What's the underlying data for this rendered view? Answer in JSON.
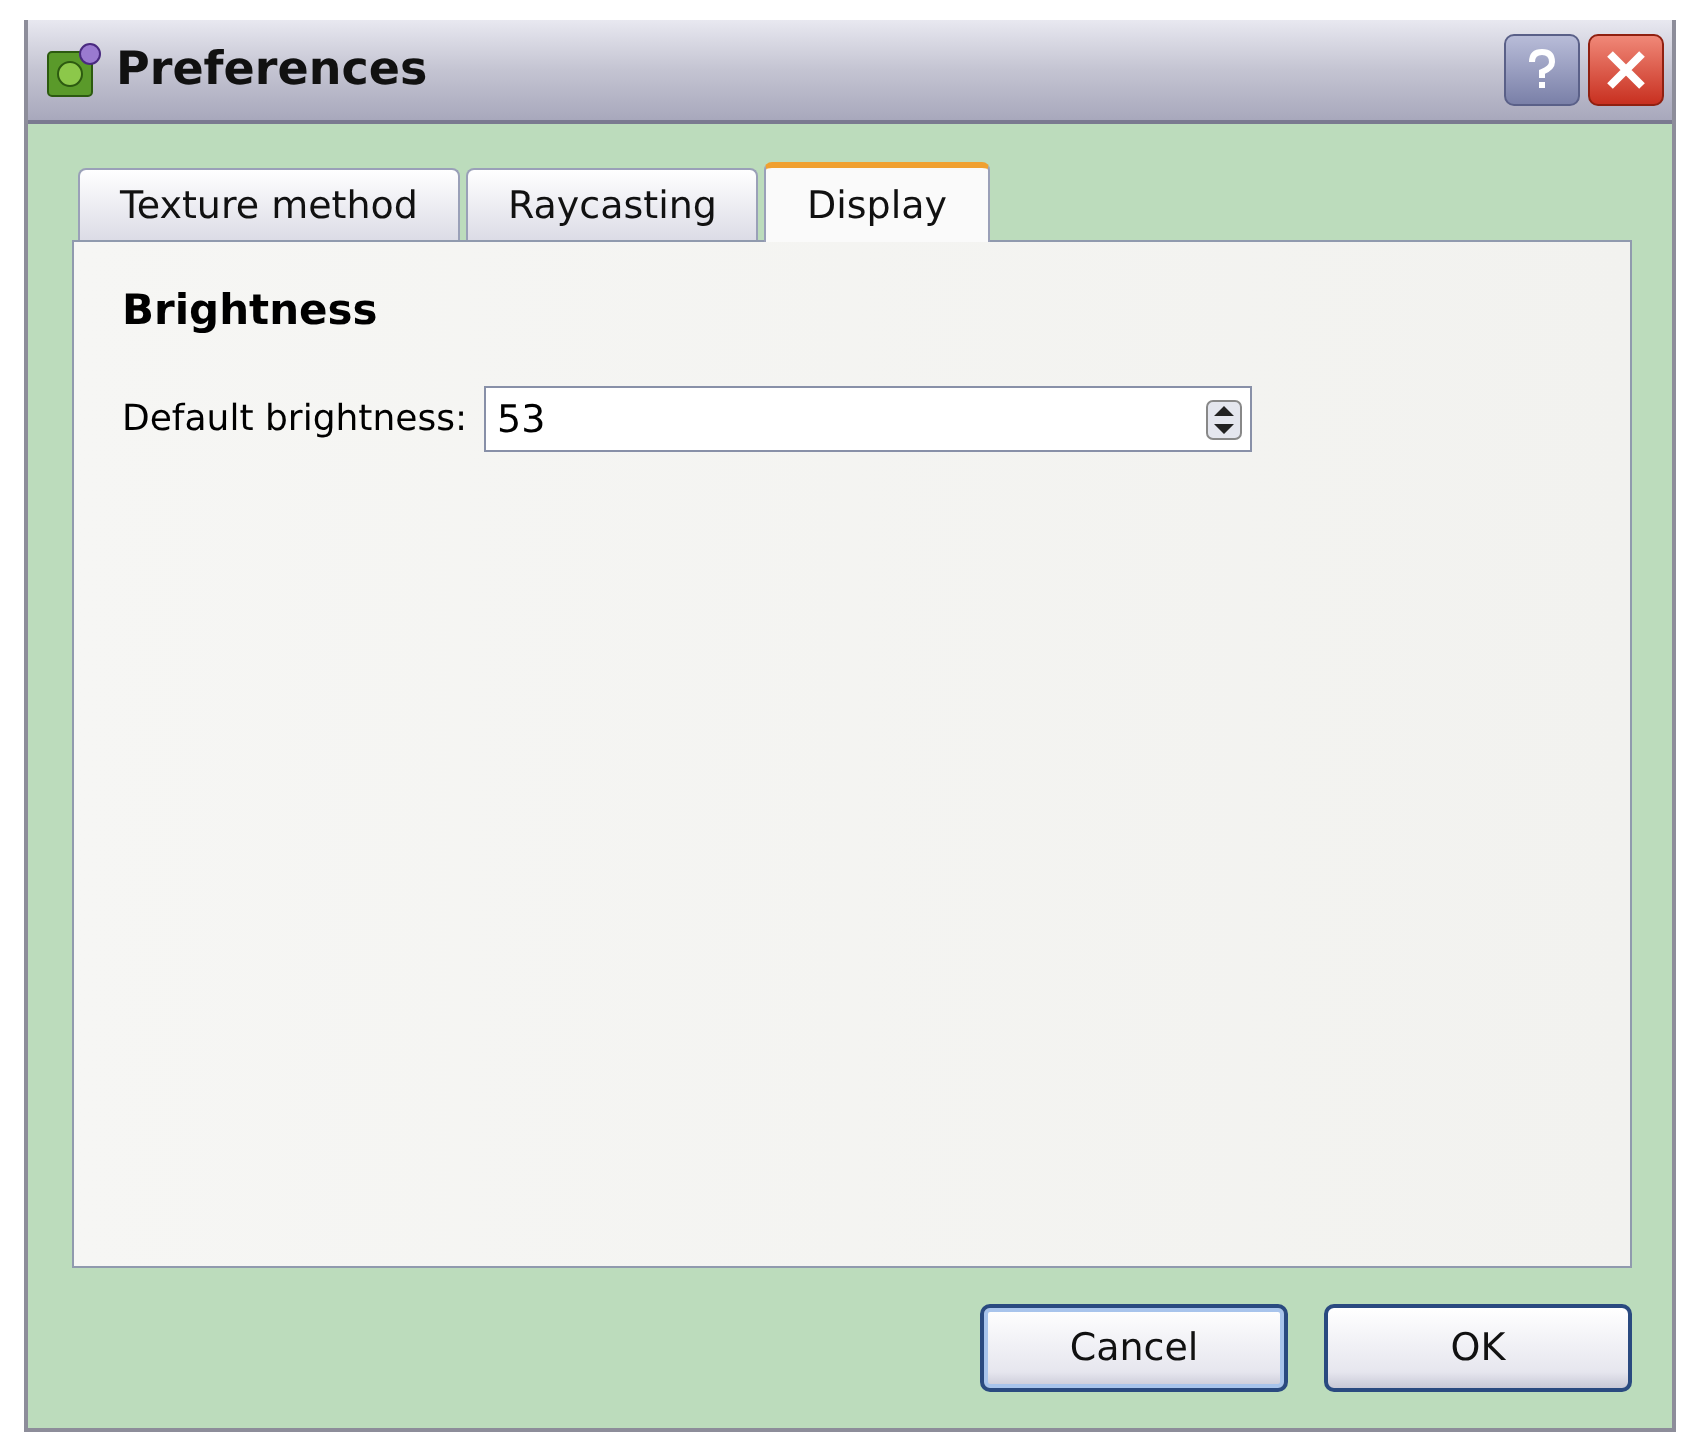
{
  "window": {
    "title": "Preferences"
  },
  "tabs": [
    {
      "label": "Texture method",
      "selected": false
    },
    {
      "label": "Raycasting",
      "selected": false
    },
    {
      "label": "Display",
      "selected": true
    }
  ],
  "section": {
    "title": "Brightness"
  },
  "fields": [
    {
      "label": "Default brightness:",
      "value": "53"
    }
  ],
  "buttons": [
    {
      "label": "Cancel",
      "default": true
    },
    {
      "label": "OK",
      "default": false
    }
  ]
}
